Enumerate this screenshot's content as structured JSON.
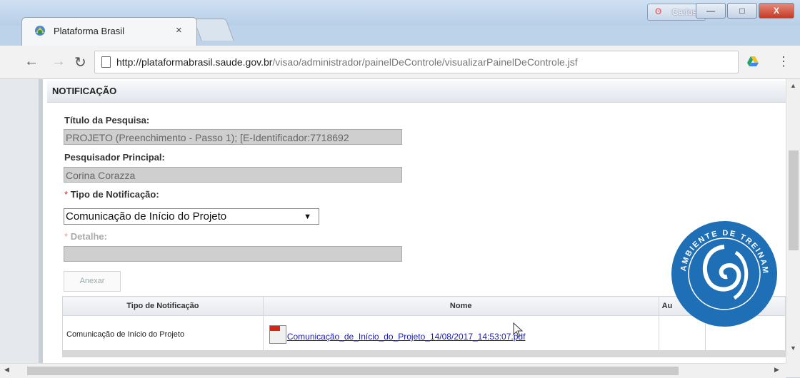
{
  "browser": {
    "tab_title": "Plataforma Brasil",
    "tab_close": "×",
    "user_badge": "Carlos",
    "url_host": "http://plataformabrasil.saude.gov.br",
    "url_path": "/visao/administrador/painelDeControle/visualizarPainelDeControle.jsf",
    "window_buttons": {
      "minimize": "—",
      "maximize": "□",
      "close": "X"
    }
  },
  "form": {
    "section_title": "NOTIFICAÇÃO",
    "titulo_label": "Título da Pesquisa:",
    "titulo_value": "PROJETO (Preenchimento - Passo 1); [E-Identificador:7718692",
    "pesquisador_label": "Pesquisador Principal:",
    "pesquisador_value": "Corina Corazza",
    "tipo_label": "Tipo de Notificação:",
    "tipo_required_mark": "*",
    "tipo_selected": "Comunicação de Início do Projeto",
    "detalhe_label": "Detalhe:",
    "detalhe_required_mark": "*",
    "detalhe_value": "",
    "attach_button": "Anexar"
  },
  "table": {
    "headers": [
      "Tipo de Notificação",
      "Nome",
      "Au"
    ],
    "rows": [
      {
        "tipo": "Comunicação de Início do Projeto",
        "nome": "Comunicação_de_Início_do_Projeto_14/08/2017_14:53:07.pdf",
        "au": ""
      }
    ]
  },
  "watermark": {
    "text": "AMBIENTE DE TREINAMENTO",
    "brand_colors": [
      "#1e6fb6",
      "#ffffff"
    ]
  },
  "colors": {
    "link": "#1b1bb8",
    "required": "#dd2222",
    "readonly_field": "#cfcfcf"
  }
}
